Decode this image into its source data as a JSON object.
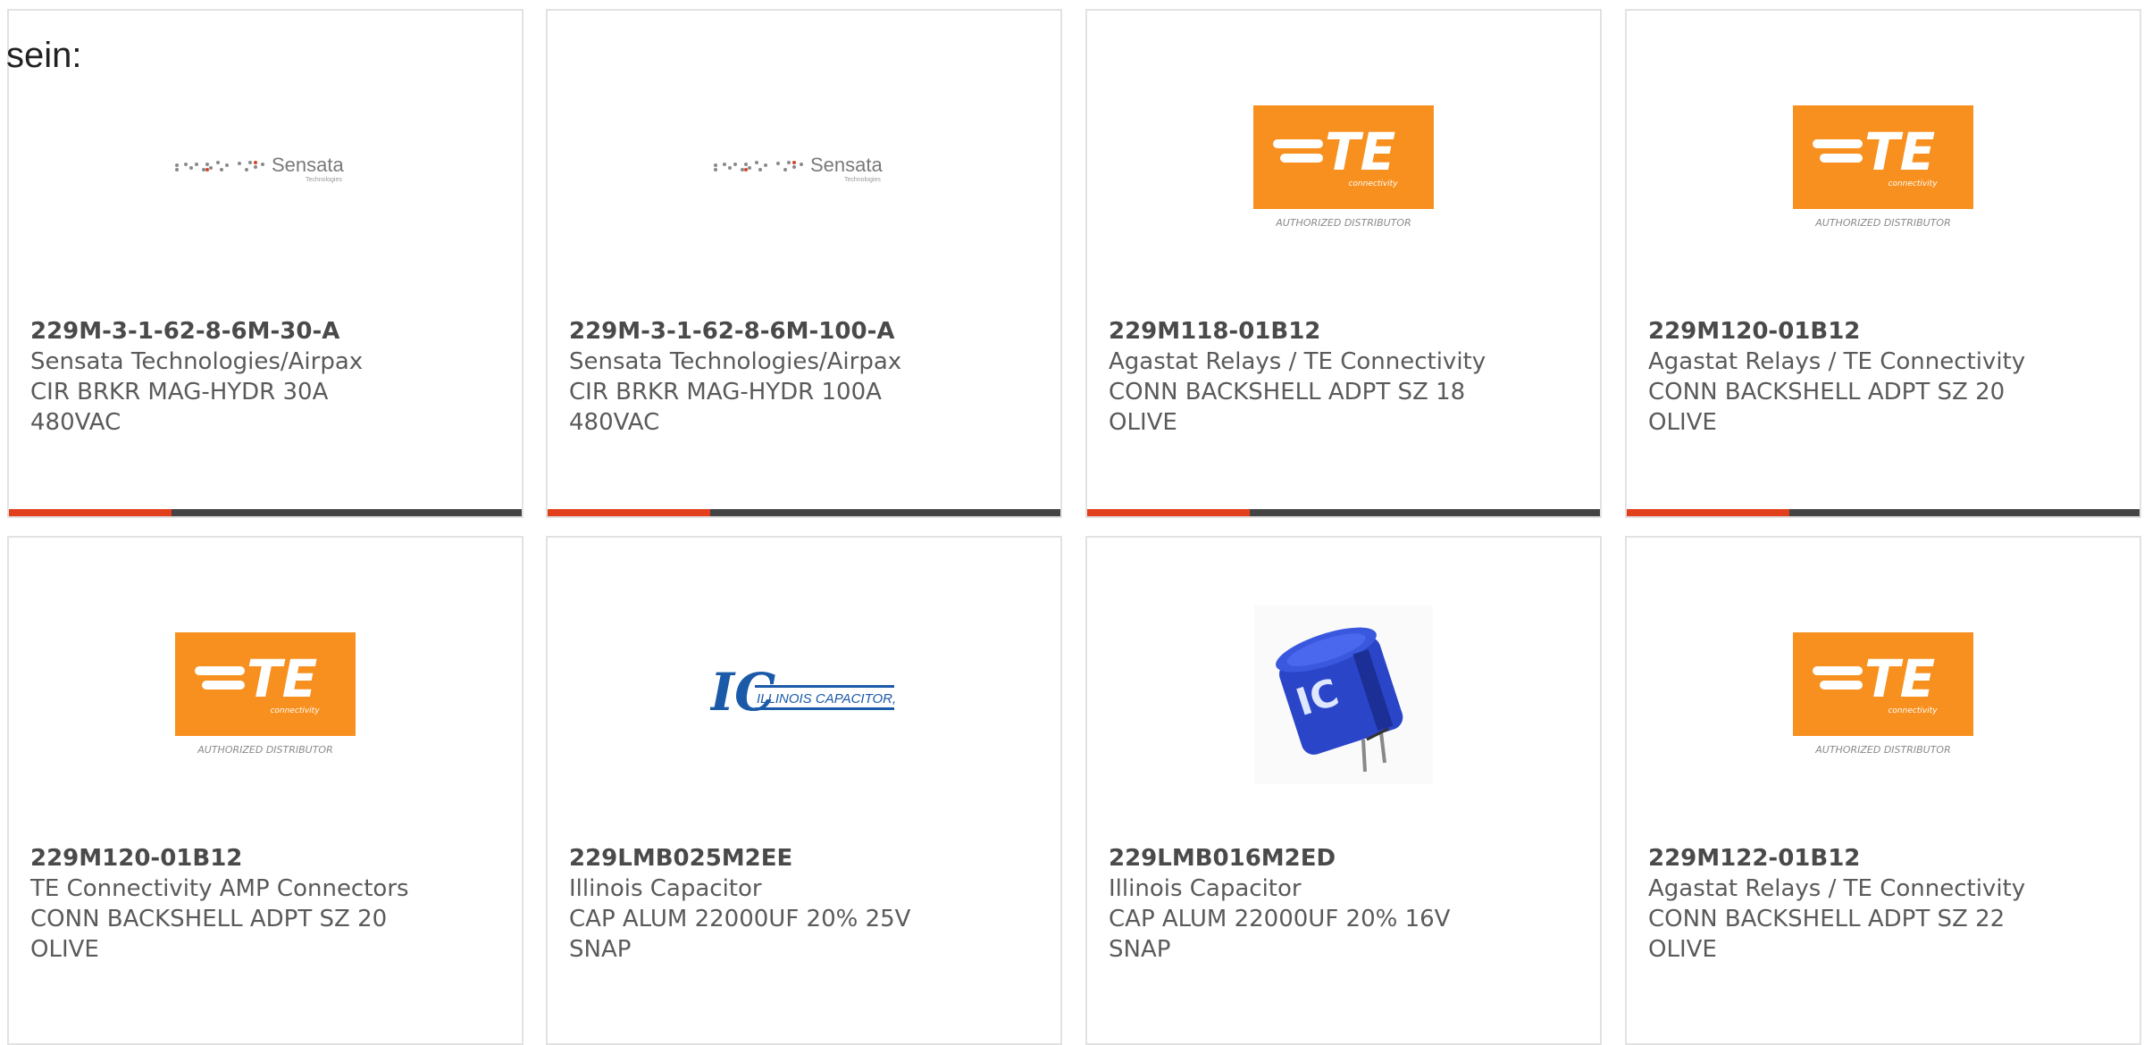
{
  "intro_text": "sein:",
  "colors": {
    "accent": "#e2401c",
    "bar": "#444444",
    "te_orange": "#f7901e",
    "ic_blue": "#1a5aa8",
    "card_border": "#e2e2e2"
  },
  "logos": {
    "sensata": {
      "name": "Sensata",
      "sub": "Technologies"
    },
    "te": {
      "mark": "TE",
      "sub": "connectivity",
      "tagline": "AUTHORIZED DISTRIBUTOR"
    },
    "ic": {
      "name": "ILLINOIS CAPACITOR, INC."
    }
  },
  "products": [
    {
      "part": "229M-3-1-62-8-6M-30-A",
      "maker": "Sensata Technologies/Airpax",
      "desc": "CIR BRKR MAG-HYDR 30A 480VAC",
      "image": "sensata-logo"
    },
    {
      "part": "229M-3-1-62-8-6M-100-A",
      "maker": "Sensata Technologies/Airpax",
      "desc": "CIR BRKR MAG-HYDR 100A 480VAC",
      "image": "sensata-logo"
    },
    {
      "part": "229M118-01B12",
      "maker": "Agastat Relays / TE Connectivity",
      "desc": "CONN BACKSHELL ADPT SZ 18 OLIVE",
      "image": "te-logo"
    },
    {
      "part": "229M120-01B12",
      "maker": "Agastat Relays / TE Connectivity",
      "desc": "CONN BACKSHELL ADPT SZ 20 OLIVE",
      "image": "te-logo"
    },
    {
      "part": "229M120-01B12",
      "maker": "TE Connectivity AMP Connectors",
      "desc": "CONN BACKSHELL ADPT SZ 20 OLIVE",
      "image": "te-logo"
    },
    {
      "part": "229LMB025M2EE",
      "maker": "Illinois Capacitor",
      "desc": "CAP ALUM 22000UF 20% 25V SNAP",
      "image": "ic-logo"
    },
    {
      "part": "229LMB016M2ED",
      "maker": "Illinois Capacitor",
      "desc": "CAP ALUM 22000UF 20% 16V SNAP",
      "image": "capacitor-photo"
    },
    {
      "part": "229M122-01B12",
      "maker": "Agastat Relays / TE Connectivity",
      "desc": "CONN BACKSHELL ADPT SZ 22 OLIVE",
      "image": "te-logo"
    }
  ]
}
